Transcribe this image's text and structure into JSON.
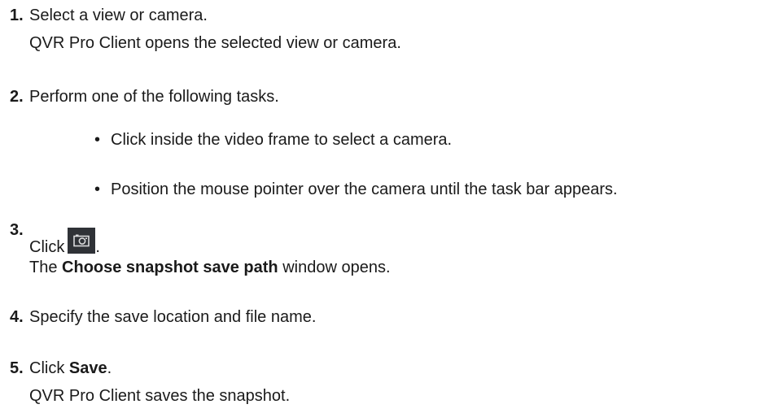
{
  "steps": [
    {
      "number": "1.",
      "line1": "Select a view or camera.",
      "line2": "QVR Pro Client opens the selected view or camera."
    },
    {
      "number": "2.",
      "line1": "Perform one of the following tasks.",
      "bullets": [
        "Click inside the video frame to select a camera.",
        "Position the mouse pointer over the camera until the task bar appears."
      ]
    },
    {
      "number": "3.",
      "click_prefix": "Click",
      "click_suffix": ".",
      "icon": "snapshot-camera-icon",
      "line2_pre": "The ",
      "line2_bold": "Choose snapshot save path",
      "line2_post": " window opens."
    },
    {
      "number": "4.",
      "line1": "Specify the save location and file name."
    },
    {
      "number": "5.",
      "line1_pre": "Click ",
      "line1_bold": "Save",
      "line1_post": ".",
      "line2": "QVR Pro Client saves the snapshot."
    }
  ],
  "colors": {
    "text": "#1a1a1a",
    "icon_bg": "#2f3237",
    "icon_fg": "#d9dadc"
  }
}
